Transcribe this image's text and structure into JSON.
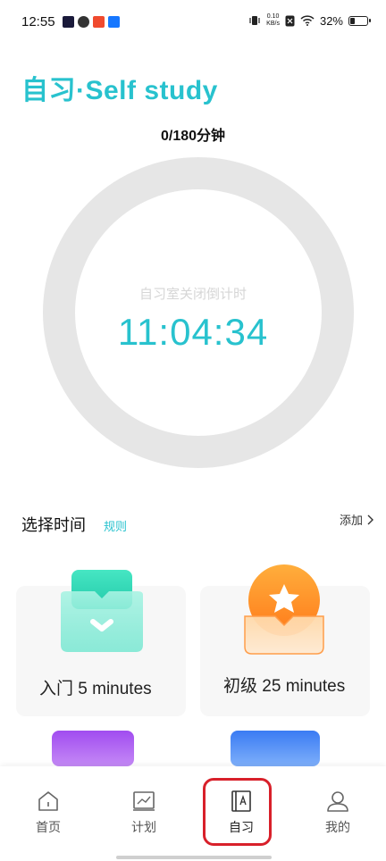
{
  "status_bar": {
    "time": "12:55",
    "net_speed_value": "0.10",
    "net_speed_unit": "KB/s",
    "battery": "32%",
    "battery_level": 0.32
  },
  "header": {
    "title": "自习·Self study"
  },
  "progress": {
    "text": "0/180分钟",
    "completed_minutes": 0,
    "total_minutes": 180
  },
  "countdown": {
    "label": "自习室关闭倒计时",
    "time": "11:04:34"
  },
  "section": {
    "title": "选择时间",
    "rules_label": "规则",
    "add_label": "添加"
  },
  "time_options": [
    {
      "label": "入门   5 minutes",
      "color": "#3ee0c0"
    },
    {
      "label": "初级   25 minutes",
      "color": "#ff9a2e"
    }
  ],
  "bottom_nav": {
    "items": [
      {
        "label": "首页"
      },
      {
        "label": "计划"
      },
      {
        "label": "自习"
      },
      {
        "label": "我的"
      }
    ],
    "active": "自习"
  },
  "colors": {
    "accent": "#28c2ce",
    "highlight": "#d8202a"
  }
}
